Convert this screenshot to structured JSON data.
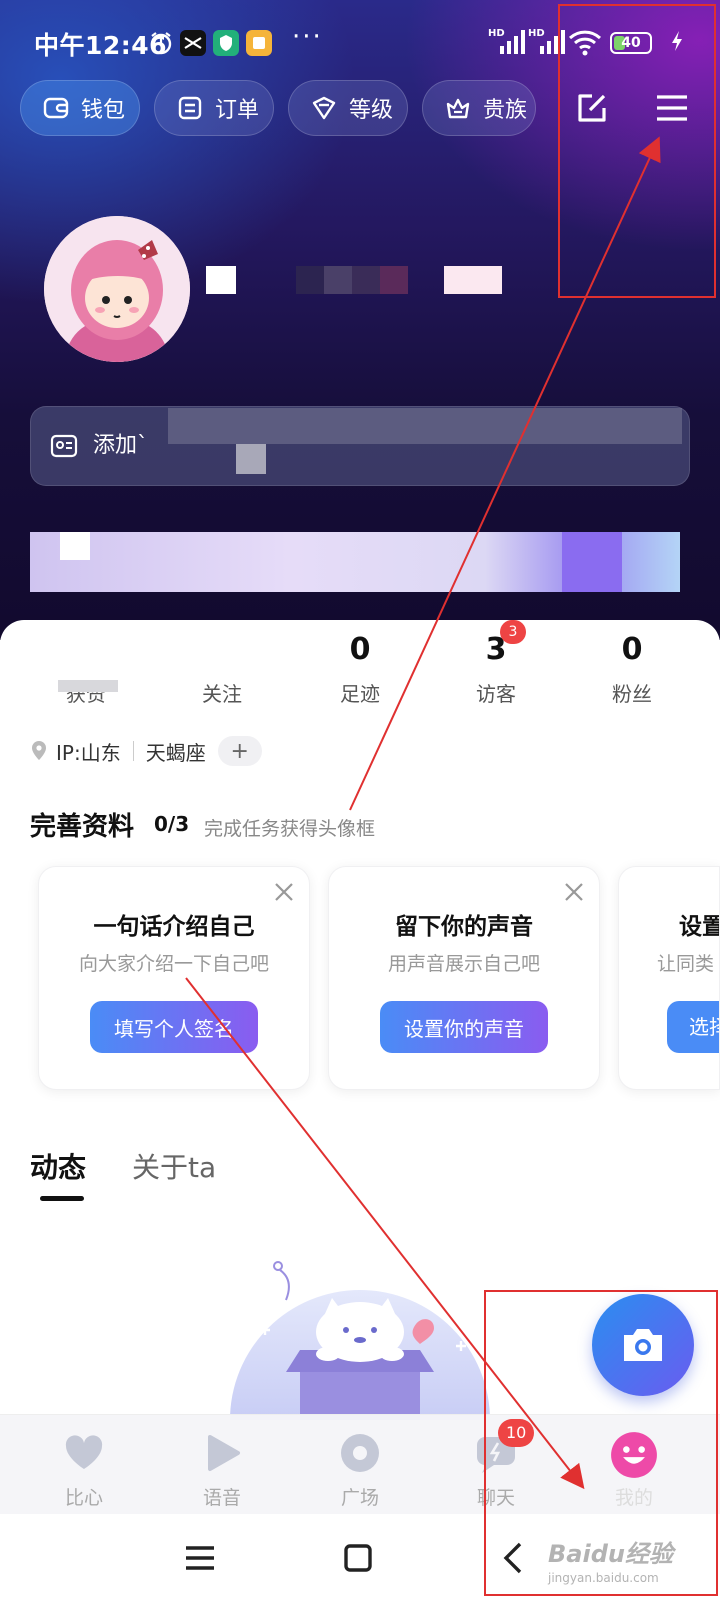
{
  "status_bar": {
    "time": "中午12:46",
    "battery": "40",
    "battery_level": 0.4
  },
  "top_chips": [
    {
      "label": "钱包",
      "icon": "wallet-icon"
    },
    {
      "label": "订单",
      "icon": "order-icon"
    },
    {
      "label": "等级",
      "icon": "level-icon"
    },
    {
      "label": "贵族",
      "icon": "crown-icon"
    }
  ],
  "top_actions": {
    "edit_icon": "edit-icon",
    "menu_icon": "menu-icon"
  },
  "profile": {
    "bio_placeholder": "添加`"
  },
  "stats": [
    {
      "value": "",
      "label": "获赞"
    },
    {
      "value": "",
      "label": "关注"
    },
    {
      "value": "0",
      "label": "足迹"
    },
    {
      "value": "3",
      "label": "访客",
      "badge": "3"
    },
    {
      "value": "0",
      "label": "粉丝"
    }
  ],
  "info": {
    "ip": "IP:山东",
    "zodiac": "天蝎座",
    "add_tag": "+"
  },
  "complete_profile": {
    "title": "完善资料",
    "progress": "0/3",
    "subtitle": "完成任务获得头像框",
    "tasks": [
      {
        "title": "一句话介绍自己",
        "desc": "向大家介绍一下自己吧",
        "button": "填写个人签名"
      },
      {
        "title": "留下你的声音",
        "desc": "用声音展示自己吧",
        "button": "设置你的声音"
      },
      {
        "title": "设置",
        "desc": "让同类",
        "button": "选择"
      }
    ]
  },
  "tabs": [
    {
      "label": "动态",
      "active": true
    },
    {
      "label": "关于ta",
      "active": false
    }
  ],
  "bottom_nav": [
    {
      "label": "比心",
      "icon": "heart-icon"
    },
    {
      "label": "语音",
      "icon": "play-icon"
    },
    {
      "label": "广场",
      "icon": "disc-icon"
    },
    {
      "label": "聊天",
      "icon": "chat-icon",
      "badge": "10"
    },
    {
      "label": "我的",
      "icon": "smile-avatar-icon",
      "active": true
    }
  ],
  "watermark": {
    "main": "Baidu经验",
    "sub": "jingyan.baidu.com"
  },
  "colors": {
    "accent_blue": "#4a8cf6",
    "accent_purple": "#8a5cf0",
    "badge_red": "#ee4444",
    "annotation_red": "#e03030"
  }
}
